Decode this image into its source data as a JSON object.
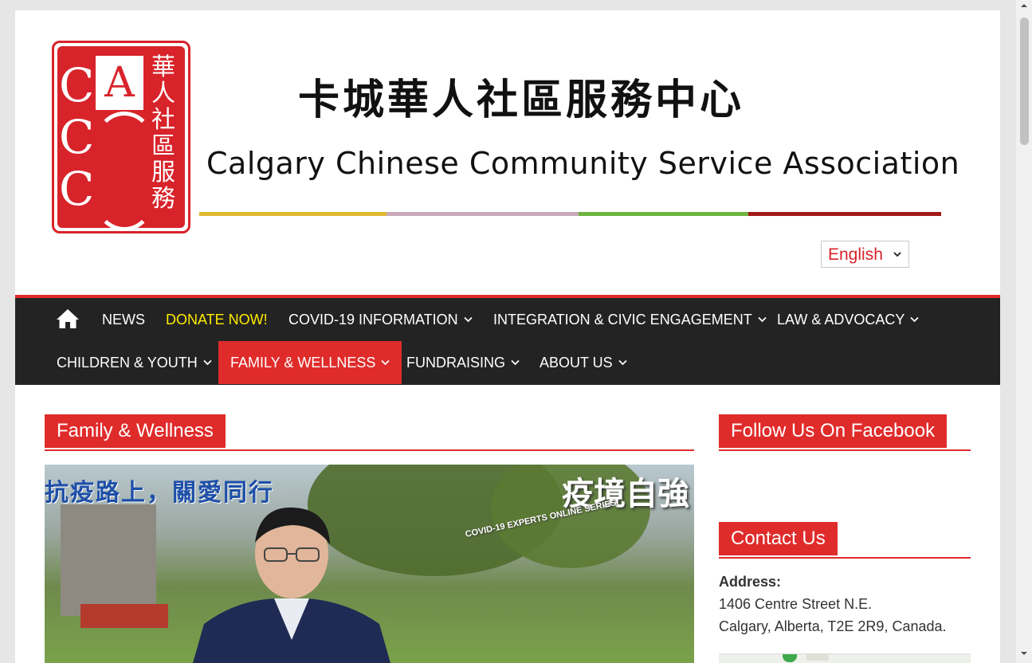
{
  "header": {
    "logo_letters": [
      "C",
      "C",
      "C"
    ],
    "logo_a": "A",
    "logo_cjk": [
      "華",
      "人",
      "社",
      "區",
      "服",
      "務"
    ],
    "title_cn": "卡城華人社區服務中心",
    "title_en": "Calgary Chinese Community Service Association",
    "color_bar": [
      "#e0b832",
      "#c9aab8",
      "#6db33f",
      "#a31919"
    ],
    "language": "English"
  },
  "nav": {
    "row1": [
      {
        "label": "NEWS",
        "chevron": false
      },
      {
        "label": "DONATE NOW!",
        "chevron": false,
        "color": "#ffeb00"
      },
      {
        "label": "COVID-19 INFORMATION",
        "chevron": true
      },
      {
        "label": "INTEGRATION & CIVIC ENGAGEMENT",
        "chevron": true
      },
      {
        "label": "LAW & ADVOCACY",
        "chevron": true
      }
    ],
    "row2": [
      {
        "label": "CHILDREN & YOUTH",
        "chevron": true
      },
      {
        "label": "FAMILY & WELLNESS",
        "chevron": true,
        "active": true
      },
      {
        "label": "FUNDRAISING",
        "chevron": true
      },
      {
        "label": "ABOUT US",
        "chevron": true
      }
    ],
    "accent": "#e02b2b"
  },
  "main": {
    "section_title": "Family & Wellness",
    "image_caption": "抗疫路上，關愛同行",
    "image_brand": "疫境自強",
    "image_brand_sub": "COVID-19 EXPERTS ONLINE SERIES"
  },
  "sidebar": {
    "facebook_title": "Follow Us On Facebook",
    "contact_title": "Contact Us",
    "address_label": "Address:",
    "address_line1": "1406 Centre Street N.E.",
    "address_line2": "Calgary, Alberta, T2E 2R9, Canada."
  }
}
